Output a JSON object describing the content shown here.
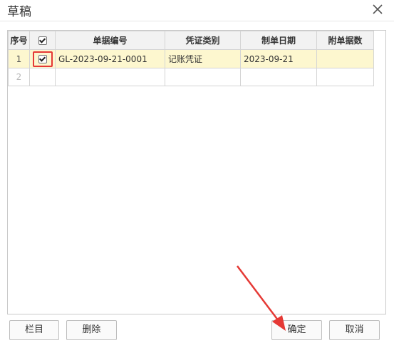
{
  "dialog": {
    "title": "草稿"
  },
  "table": {
    "columns": [
      "序号",
      "",
      "单据编号",
      "凭证类别",
      "制单日期",
      "附单据数"
    ],
    "rows": [
      {
        "index": "1",
        "checked": true,
        "doc_no": "GL-2023-09-21-0001",
        "voucher_type": "记账凭证",
        "date": "2023-09-21",
        "attachments": ""
      },
      {
        "index": "2",
        "checked": false,
        "doc_no": "",
        "voucher_type": "",
        "date": "",
        "attachments": ""
      }
    ]
  },
  "buttons": {
    "columns_label": "栏目",
    "delete_label": "删除",
    "ok_label": "确定",
    "cancel_label": "取消"
  },
  "colors": {
    "selected_row": "#fdf7cf",
    "highlight": "#e53935"
  }
}
